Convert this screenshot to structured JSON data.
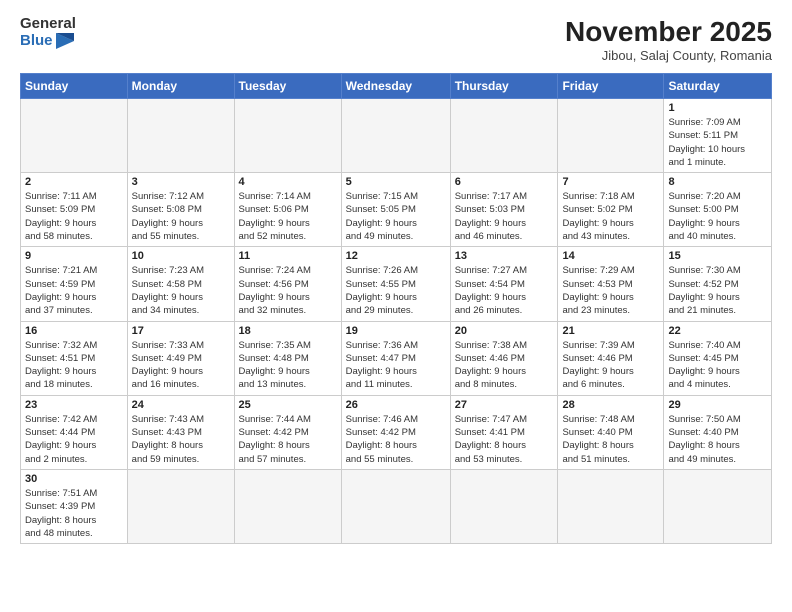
{
  "header": {
    "logo_general": "General",
    "logo_blue": "Blue",
    "month_title": "November 2025",
    "location": "Jibou, Salaj County, Romania"
  },
  "weekdays": [
    "Sunday",
    "Monday",
    "Tuesday",
    "Wednesday",
    "Thursday",
    "Friday",
    "Saturday"
  ],
  "weeks": [
    [
      {
        "day": "",
        "info": ""
      },
      {
        "day": "",
        "info": ""
      },
      {
        "day": "",
        "info": ""
      },
      {
        "day": "",
        "info": ""
      },
      {
        "day": "",
        "info": ""
      },
      {
        "day": "",
        "info": ""
      },
      {
        "day": "1",
        "info": "Sunrise: 7:09 AM\nSunset: 5:11 PM\nDaylight: 10 hours\nand 1 minute."
      }
    ],
    [
      {
        "day": "2",
        "info": "Sunrise: 7:11 AM\nSunset: 5:09 PM\nDaylight: 9 hours\nand 58 minutes."
      },
      {
        "day": "3",
        "info": "Sunrise: 7:12 AM\nSunset: 5:08 PM\nDaylight: 9 hours\nand 55 minutes."
      },
      {
        "day": "4",
        "info": "Sunrise: 7:14 AM\nSunset: 5:06 PM\nDaylight: 9 hours\nand 52 minutes."
      },
      {
        "day": "5",
        "info": "Sunrise: 7:15 AM\nSunset: 5:05 PM\nDaylight: 9 hours\nand 49 minutes."
      },
      {
        "day": "6",
        "info": "Sunrise: 7:17 AM\nSunset: 5:03 PM\nDaylight: 9 hours\nand 46 minutes."
      },
      {
        "day": "7",
        "info": "Sunrise: 7:18 AM\nSunset: 5:02 PM\nDaylight: 9 hours\nand 43 minutes."
      },
      {
        "day": "8",
        "info": "Sunrise: 7:20 AM\nSunset: 5:00 PM\nDaylight: 9 hours\nand 40 minutes."
      }
    ],
    [
      {
        "day": "9",
        "info": "Sunrise: 7:21 AM\nSunset: 4:59 PM\nDaylight: 9 hours\nand 37 minutes."
      },
      {
        "day": "10",
        "info": "Sunrise: 7:23 AM\nSunset: 4:58 PM\nDaylight: 9 hours\nand 34 minutes."
      },
      {
        "day": "11",
        "info": "Sunrise: 7:24 AM\nSunset: 4:56 PM\nDaylight: 9 hours\nand 32 minutes."
      },
      {
        "day": "12",
        "info": "Sunrise: 7:26 AM\nSunset: 4:55 PM\nDaylight: 9 hours\nand 29 minutes."
      },
      {
        "day": "13",
        "info": "Sunrise: 7:27 AM\nSunset: 4:54 PM\nDaylight: 9 hours\nand 26 minutes."
      },
      {
        "day": "14",
        "info": "Sunrise: 7:29 AM\nSunset: 4:53 PM\nDaylight: 9 hours\nand 23 minutes."
      },
      {
        "day": "15",
        "info": "Sunrise: 7:30 AM\nSunset: 4:52 PM\nDaylight: 9 hours\nand 21 minutes."
      }
    ],
    [
      {
        "day": "16",
        "info": "Sunrise: 7:32 AM\nSunset: 4:51 PM\nDaylight: 9 hours\nand 18 minutes."
      },
      {
        "day": "17",
        "info": "Sunrise: 7:33 AM\nSunset: 4:49 PM\nDaylight: 9 hours\nand 16 minutes."
      },
      {
        "day": "18",
        "info": "Sunrise: 7:35 AM\nSunset: 4:48 PM\nDaylight: 9 hours\nand 13 minutes."
      },
      {
        "day": "19",
        "info": "Sunrise: 7:36 AM\nSunset: 4:47 PM\nDaylight: 9 hours\nand 11 minutes."
      },
      {
        "day": "20",
        "info": "Sunrise: 7:38 AM\nSunset: 4:46 PM\nDaylight: 9 hours\nand 8 minutes."
      },
      {
        "day": "21",
        "info": "Sunrise: 7:39 AM\nSunset: 4:46 PM\nDaylight: 9 hours\nand 6 minutes."
      },
      {
        "day": "22",
        "info": "Sunrise: 7:40 AM\nSunset: 4:45 PM\nDaylight: 9 hours\nand 4 minutes."
      }
    ],
    [
      {
        "day": "23",
        "info": "Sunrise: 7:42 AM\nSunset: 4:44 PM\nDaylight: 9 hours\nand 2 minutes."
      },
      {
        "day": "24",
        "info": "Sunrise: 7:43 AM\nSunset: 4:43 PM\nDaylight: 8 hours\nand 59 minutes."
      },
      {
        "day": "25",
        "info": "Sunrise: 7:44 AM\nSunset: 4:42 PM\nDaylight: 8 hours\nand 57 minutes."
      },
      {
        "day": "26",
        "info": "Sunrise: 7:46 AM\nSunset: 4:42 PM\nDaylight: 8 hours\nand 55 minutes."
      },
      {
        "day": "27",
        "info": "Sunrise: 7:47 AM\nSunset: 4:41 PM\nDaylight: 8 hours\nand 53 minutes."
      },
      {
        "day": "28",
        "info": "Sunrise: 7:48 AM\nSunset: 4:40 PM\nDaylight: 8 hours\nand 51 minutes."
      },
      {
        "day": "29",
        "info": "Sunrise: 7:50 AM\nSunset: 4:40 PM\nDaylight: 8 hours\nand 49 minutes."
      }
    ],
    [
      {
        "day": "30",
        "info": "Sunrise: 7:51 AM\nSunset: 4:39 PM\nDaylight: 8 hours\nand 48 minutes."
      },
      {
        "day": "",
        "info": ""
      },
      {
        "day": "",
        "info": ""
      },
      {
        "day": "",
        "info": ""
      },
      {
        "day": "",
        "info": ""
      },
      {
        "day": "",
        "info": ""
      },
      {
        "day": "",
        "info": ""
      }
    ]
  ]
}
